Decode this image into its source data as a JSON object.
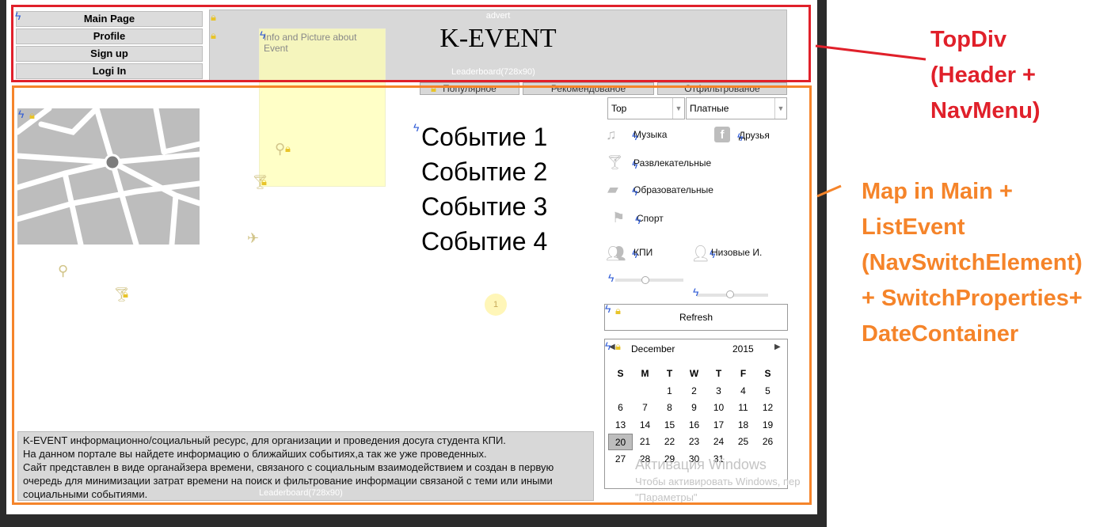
{
  "nav": {
    "main_page": "Main Page",
    "profile": "Profile",
    "sign_up": "Sign up",
    "log_in": "Logi In"
  },
  "header": {
    "advert": "advert",
    "title": "K-EVENT",
    "leaderboard": "Leaderboard(728x90)",
    "info_box": "Info and Picture about Event"
  },
  "tabs": [
    "Популярное",
    "Рекомендованое",
    "Отфильтрованое"
  ],
  "events": [
    "Событие 1",
    "Событие 2",
    "Событие 3",
    "Событие 4"
  ],
  "filters": {
    "select_1": "Top",
    "select_2": "Платные"
  },
  "categories": {
    "music": "Музыка",
    "friends": "Друзья",
    "entertainment": "Развлекательные",
    "educational": "Образовательные",
    "sport": "Спорт",
    "kpi": "КПИ",
    "nizovye": "Низовые И."
  },
  "refresh_label": "Refresh",
  "calendar": {
    "month": "December",
    "year": "2015",
    "days_of_week": [
      "S",
      "M",
      "T",
      "W",
      "T",
      "F",
      "S"
    ],
    "weeks": [
      [
        "",
        "",
        "1",
        "2",
        "3",
        "4",
        "5"
      ],
      [
        "6",
        "7",
        "8",
        "9",
        "10",
        "11",
        "12"
      ],
      [
        "13",
        "14",
        "15",
        "16",
        "17",
        "18",
        "19"
      ],
      [
        "20",
        "21",
        "22",
        "23",
        "24",
        "25",
        "26"
      ],
      [
        "27",
        "28",
        "29",
        "30",
        "31",
        "",
        ""
      ]
    ],
    "selected_day": "20"
  },
  "map_marker_number": "1",
  "description": {
    "line1": "K-EVENT информационно/социальный ресурс, для организации и проведения досуга студента КПИ.",
    "line2": "На данном портале вы найдете информацию о ближайших событиях,а так же уже проведенных.",
    "line3": "Сайт представлен в виде органайзера времени, связаного с социальным взаимодействием и создан в первую очередь для минимизации затрат времени на поиск и фильтрование информации связаной с теми или иными социальными событиями.",
    "leaderboard": "Leaderboard(728x90)"
  },
  "windows_activation": {
    "title": "Активация Windows",
    "line1": "Чтобы активировать Windows, пер",
    "line2": "\"Параметры\""
  },
  "annotations": {
    "top_div": [
      "TopDiv",
      "(Header +",
      "NavMenu)"
    ],
    "main": [
      "Map in Main +",
      "ListEvent",
      "(NavSwitchElement)",
      "+ SwitchProperties+",
      "DateContainer"
    ]
  },
  "colors": {
    "red_annotation": "#e0202a",
    "orange_annotation": "#f5842a",
    "panel_gray": "#d8d8d8"
  }
}
